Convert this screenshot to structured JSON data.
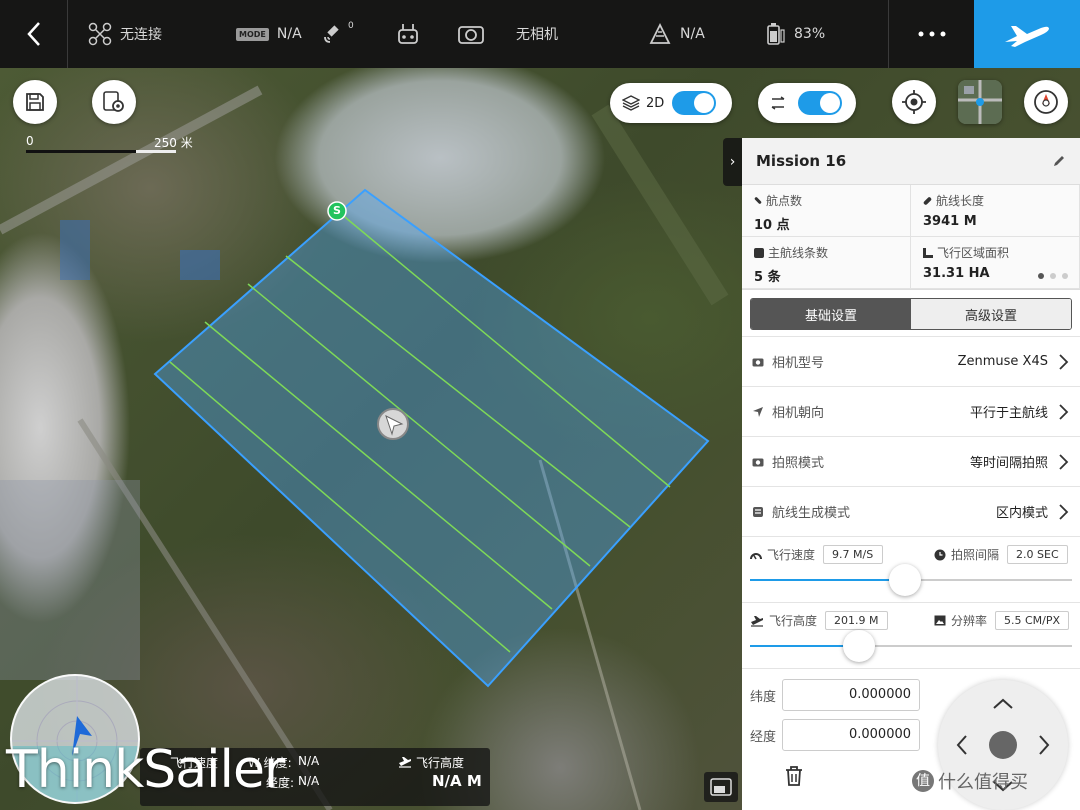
{
  "topbar": {
    "back_icon": "chevron-left-icon",
    "aircraft_status": "无连接",
    "mode_badge": "MODE",
    "mode_value": "N/A",
    "satellite_count": "0",
    "camera_status": "无相机",
    "altitude_limit": "N/A",
    "battery": "83%"
  },
  "map_controls": {
    "view_mode_label": "2D",
    "view_mode_on": true,
    "overlay_toggle_on": true,
    "scale_start": "0",
    "scale_end": "250 米"
  },
  "mission": {
    "title": "Mission 16",
    "stats": [
      {
        "label": "航点数",
        "value": "10 点"
      },
      {
        "label": "航线长度",
        "value": "3941 M"
      },
      {
        "label": "主航线条数",
        "value": "5 条"
      },
      {
        "label": "飞行区域面积",
        "value": "31.31 HA"
      }
    ],
    "tabs": [
      "基础设置",
      "高级设置"
    ],
    "active_tab": 0,
    "settings": [
      {
        "label": "相机型号",
        "value": "Zenmuse X4S",
        "icon": "camera-icon"
      },
      {
        "label": "相机朝向",
        "value": "平行于主航线",
        "icon": "direction-arrow-icon"
      },
      {
        "label": "拍照模式",
        "value": "等时间隔拍照",
        "icon": "camera-icon"
      },
      {
        "label": "航线生成模式",
        "value": "区内模式",
        "icon": "route-icon"
      }
    ],
    "speed": {
      "label": "飞行速度",
      "value": "9.7 M/S",
      "interval_label": "拍照间隔",
      "interval_value": "2.0 SEC",
      "level": 0.48
    },
    "height": {
      "label": "飞行高度",
      "value": "201.9 M",
      "resolution_label": "分辨率",
      "resolution_value": "5.5 CM/PX",
      "level": 0.34
    },
    "latitude": {
      "label": "纬度",
      "value": "0.000000"
    },
    "longitude": {
      "label": "经度",
      "value": "0.000000"
    }
  },
  "telemetry": {
    "speed_label": "飞行速度",
    "lat_label": "W 纬度:",
    "lat_value": "N/A",
    "lon_label": "经度:",
    "lon_value": "N/A",
    "alt_label": "飞行高度",
    "alt_value": "N/A M"
  },
  "map": {
    "start_marker": "S"
  },
  "watermark": "ThinkSailer",
  "stamp": "什么值得买",
  "colors": {
    "accent": "#1e9be8",
    "polygon_stroke": "#3aa0ff",
    "route_line": "#7ed957",
    "start_marker": "#22c35e"
  }
}
